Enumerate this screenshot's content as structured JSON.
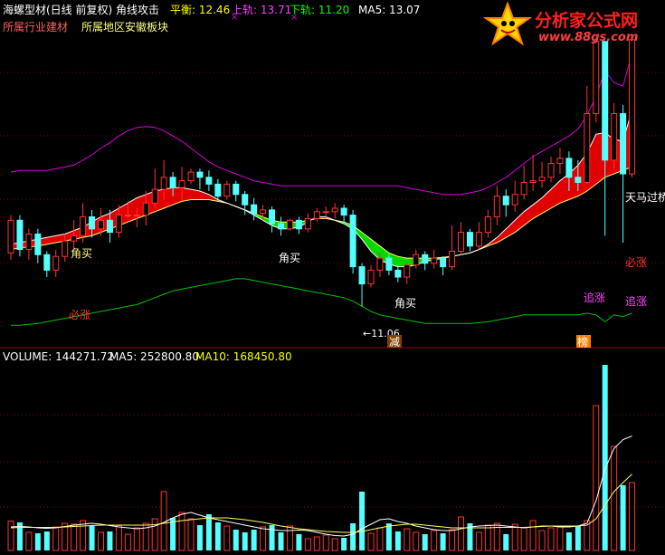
{
  "header": {
    "title": "海螺型材(日线 前复权) 角线攻击",
    "balance_label": "平衡: 12.46",
    "upper_label": "上轨: 13.71",
    "lower_label": "下轨: 11.20",
    "ma5_label": "MA5: 13.07",
    "industry": "所属行业建材",
    "region": "所属地区安徽板块"
  },
  "logo": {
    "name": "分析家公式网",
    "url": "www.88gs.com"
  },
  "volume_header": {
    "volume": "VOLUME: 144271.72",
    "ma5": "MA5: 252800.80",
    "ma10": "MA10: 168450.80"
  },
  "annotations": {
    "buy1": "角买",
    "buy2": "角买",
    "buy3": "角买",
    "bizhang1": "必涨",
    "bizhang2": "必涨",
    "zhuizhang1": "追涨",
    "zhuizhang2": "追涨",
    "low": "←11.06",
    "jian": "减",
    "bang": "榜",
    "tianma": "天马过桥"
  },
  "colors": {
    "up": "#ff3232",
    "down": "#54ffff",
    "upper_band": "#d400d4",
    "lower_band": "#00c000",
    "ma_white": "#ffffff",
    "ma_yellow": "#ffff60",
    "red_fill": "#e00000",
    "green_fill": "#00d800",
    "grid": "#800000",
    "balance": "#ffff00",
    "upper_text": "#ff40ff",
    "lower_text": "#00ff00",
    "industry": "#ff6060",
    "region": "#ffff80"
  },
  "chart_data": [
    {
      "type": "candlestick",
      "title": "海螺型材(日线 前复权) 角线攻击",
      "ylim": [
        10.6,
        14.2
      ],
      "candles": [
        [
          11.68,
          12.06,
          11.6,
          12.12
        ],
        [
          12.06,
          11.72,
          11.64,
          12.12
        ],
        [
          11.72,
          11.9,
          11.6,
          11.96
        ],
        [
          11.9,
          11.66,
          11.56,
          11.96
        ],
        [
          11.66,
          11.48,
          11.4,
          11.7
        ],
        [
          11.48,
          11.64,
          11.4,
          11.72
        ],
        [
          11.64,
          11.82,
          11.58,
          11.9
        ],
        [
          11.82,
          11.88,
          11.74,
          12.06
        ],
        [
          11.88,
          12.1,
          11.8,
          12.26
        ],
        [
          12.1,
          11.96,
          11.86,
          12.18
        ],
        [
          11.96,
          12.06,
          11.88,
          12.2
        ],
        [
          12.06,
          11.92,
          11.8,
          12.18
        ],
        [
          11.92,
          12.12,
          11.86,
          12.24
        ],
        [
          12.12,
          12.12,
          12.08,
          12.28
        ],
        [
          12.12,
          12.12,
          11.98,
          12.2
        ],
        [
          12.12,
          12.26,
          12.0,
          12.4
        ],
        [
          12.26,
          12.42,
          12.2,
          12.66
        ],
        [
          12.42,
          12.56,
          12.3,
          12.76
        ],
        [
          12.56,
          12.44,
          12.34,
          12.62
        ],
        [
          12.44,
          12.52,
          12.3,
          12.68
        ],
        [
          12.52,
          12.62,
          12.48,
          12.66
        ],
        [
          12.62,
          12.56,
          12.42,
          12.66
        ],
        [
          12.56,
          12.48,
          12.4,
          12.64
        ],
        [
          12.48,
          12.34,
          12.28,
          12.54
        ],
        [
          12.34,
          12.48,
          12.3,
          12.52
        ],
        [
          12.48,
          12.36,
          12.28,
          12.52
        ],
        [
          12.36,
          12.24,
          12.12,
          12.4
        ],
        [
          12.24,
          12.14,
          12.06,
          12.32
        ],
        [
          12.14,
          12.18,
          12.06,
          12.24
        ],
        [
          12.18,
          12.02,
          11.92,
          12.22
        ],
        [
          12.02,
          11.96,
          11.88,
          12.1
        ],
        [
          11.96,
          12.06,
          11.94,
          12.08
        ],
        [
          12.06,
          11.96,
          11.9,
          12.1
        ],
        [
          11.96,
          12.08,
          11.92,
          12.14
        ],
        [
          12.08,
          12.16,
          12.04,
          12.2
        ],
        [
          12.16,
          12.16,
          12.1,
          12.22
        ],
        [
          12.16,
          12.2,
          12.08,
          12.26
        ],
        [
          12.2,
          12.12,
          12.02,
          12.24
        ],
        [
          12.12,
          11.52,
          11.44,
          12.18
        ],
        [
          11.52,
          11.32,
          11.06,
          11.56
        ],
        [
          11.32,
          11.48,
          11.28,
          11.54
        ],
        [
          11.48,
          11.62,
          11.4,
          11.68
        ],
        [
          11.62,
          11.48,
          11.42,
          11.66
        ],
        [
          11.48,
          11.4,
          11.34,
          11.54
        ],
        [
          11.4,
          11.54,
          11.32,
          11.56
        ],
        [
          11.54,
          11.66,
          11.5,
          11.72
        ],
        [
          11.66,
          11.56,
          11.48,
          11.7
        ],
        [
          11.56,
          11.62,
          11.5,
          11.72
        ],
        [
          11.62,
          11.52,
          11.42,
          11.64
        ],
        [
          11.52,
          11.7,
          11.48,
          12.0
        ],
        [
          11.7,
          11.92,
          11.66,
          12.04
        ],
        [
          11.92,
          11.76,
          11.7,
          11.96
        ],
        [
          11.76,
          11.92,
          11.72,
          12.04
        ],
        [
          11.92,
          12.1,
          11.86,
          12.18
        ],
        [
          12.1,
          12.34,
          12.0,
          12.46
        ],
        [
          12.34,
          12.24,
          12.1,
          12.42
        ],
        [
          12.24,
          12.36,
          12.16,
          12.52
        ],
        [
          12.36,
          12.5,
          12.3,
          12.7
        ],
        [
          12.5,
          12.52,
          12.4,
          12.82
        ],
        [
          12.52,
          12.56,
          12.44,
          12.74
        ],
        [
          12.56,
          12.72,
          12.5,
          12.8
        ],
        [
          12.72,
          12.78,
          12.6,
          12.9
        ],
        [
          12.78,
          12.56,
          12.4,
          12.86
        ],
        [
          12.56,
          12.5,
          12.4,
          12.76
        ],
        [
          12.5,
          13.3,
          12.48,
          13.62
        ],
        [
          13.3,
          14.14,
          13.2,
          14.16
        ],
        [
          14.14,
          12.76,
          11.88,
          14.14
        ],
        [
          12.76,
          13.3,
          12.66,
          13.42
        ],
        [
          13.3,
          12.6,
          11.8,
          13.4
        ],
        [
          12.6,
          14.16,
          12.56,
          14.16
        ]
      ]
    },
    {
      "type": "line",
      "series": [
        {
          "name": "上轨",
          "color": "#d400d4",
          "values": [
            12.62,
            12.64,
            12.64,
            12.64,
            12.64,
            12.66,
            12.68,
            12.7,
            12.76,
            12.82,
            12.9,
            12.96,
            13.04,
            13.1,
            13.14,
            13.15,
            13.14,
            13.1,
            13.04,
            12.98,
            12.9,
            12.82,
            12.74,
            12.68,
            12.64,
            12.6,
            12.56,
            12.52,
            12.5,
            12.48,
            12.46,
            12.46,
            12.46,
            12.46,
            12.46,
            12.46,
            12.46,
            12.46,
            12.46,
            12.46,
            12.46,
            12.46,
            12.46,
            12.46,
            12.44,
            12.42,
            12.4,
            12.38,
            12.36,
            12.36,
            12.36,
            12.38,
            12.4,
            12.44,
            12.5,
            12.56,
            12.64,
            12.72,
            12.8,
            12.86,
            12.92,
            12.98,
            13.04,
            13.12,
            13.28,
            13.5,
            13.8,
            13.66,
            13.62,
            14.0
          ]
        },
        {
          "name": "平衡",
          "color": "#ffffff",
          "values": [
            11.78,
            11.8,
            11.82,
            11.84,
            11.86,
            11.88,
            11.9,
            11.94,
            11.98,
            12.04,
            12.1,
            12.14,
            12.2,
            12.26,
            12.32,
            12.36,
            12.4,
            12.42,
            12.44,
            12.44,
            12.42,
            12.4,
            12.36,
            12.3,
            12.26,
            12.22,
            12.18,
            12.12,
            12.06,
            12.0,
            11.96,
            11.96,
            11.98,
            12.04,
            12.1,
            12.1,
            12.06,
            12.02,
            11.96,
            11.84,
            11.7,
            11.6,
            11.55,
            11.52,
            11.52,
            11.54,
            11.58,
            11.6,
            11.62,
            11.64,
            11.66,
            11.68,
            11.72,
            11.78,
            11.86,
            11.96,
            12.06,
            12.16,
            12.24,
            12.32,
            12.42,
            12.52,
            12.6,
            12.7,
            12.84,
            13.06,
            13.08,
            13.0,
            12.98,
            13.34
          ]
        },
        {
          "name": "MA5",
          "color": "#ffff60",
          "values": [
            11.72,
            11.74,
            11.75,
            11.76,
            11.78,
            11.8,
            11.82,
            11.84,
            11.86,
            11.88,
            11.92,
            11.96,
            12.0,
            12.04,
            12.08,
            12.12,
            12.16,
            12.2,
            12.24,
            12.28,
            12.3,
            12.3,
            12.3,
            12.28,
            12.26,
            12.22,
            12.18,
            12.14,
            12.1,
            12.06,
            12.04,
            12.04,
            12.04,
            12.06,
            12.08,
            12.08,
            12.06,
            12.04,
            12.0,
            11.92,
            11.84,
            11.76,
            11.68,
            11.64,
            11.62,
            11.62,
            11.62,
            11.62,
            11.63,
            11.64,
            11.66,
            11.68,
            11.72,
            11.76,
            11.8,
            11.86,
            11.92,
            12.0,
            12.08,
            12.14,
            12.2,
            12.26,
            12.3,
            12.34,
            12.4,
            12.48,
            12.56,
            12.6,
            12.64,
            12.68
          ]
        },
        {
          "name": "下轨",
          "color": "#00c000",
          "values": [
            10.84,
            10.84,
            10.85,
            10.86,
            10.88,
            10.9,
            10.92,
            10.94,
            10.96,
            10.98,
            11.0,
            11.02,
            11.04,
            11.06,
            11.08,
            11.12,
            11.16,
            11.2,
            11.24,
            11.26,
            11.28,
            11.3,
            11.32,
            11.34,
            11.36,
            11.38,
            11.38,
            11.36,
            11.34,
            11.32,
            11.3,
            11.28,
            11.26,
            11.24,
            11.22,
            11.2,
            11.18,
            11.16,
            11.12,
            11.06,
            11.0,
            10.96,
            10.94,
            10.92,
            10.9,
            10.88,
            10.86,
            10.86,
            10.86,
            10.86,
            10.86,
            10.86,
            10.87,
            10.88,
            10.9,
            10.92,
            10.94,
            10.96,
            10.96,
            10.96,
            10.96,
            10.96,
            10.96,
            10.96,
            10.98,
            10.96,
            10.88,
            10.96,
            10.94,
            10.98
          ]
        }
      ]
    },
    {
      "type": "bar",
      "title": "VOLUME: 144271.72",
      "ylim": [
        0,
        420000
      ],
      "values": [
        65000,
        62000,
        40000,
        38000,
        42000,
        52000,
        60000,
        58000,
        66000,
        55000,
        40000,
        42000,
        55000,
        36000,
        50000,
        60000,
        70000,
        130000,
        72000,
        84000,
        70000,
        56000,
        80000,
        62000,
        54000,
        46000,
        40000,
        46000,
        52000,
        56000,
        40000,
        54000,
        36000,
        26000,
        30000,
        34000,
        26000,
        28000,
        60000,
        130000,
        38000,
        50000,
        60000,
        42000,
        48000,
        40000,
        36000,
        44000,
        38000,
        46000,
        74000,
        60000,
        40000,
        56000,
        60000,
        36000,
        58000,
        50000,
        66000,
        44000,
        50000,
        52000,
        40000,
        55000,
        66000,
        320000,
        410000,
        230000,
        144271.72,
        150000
      ],
      "ma5": [
        52000,
        53000,
        52000,
        50000,
        49000,
        50000,
        53000,
        56000,
        58000,
        60000,
        58000,
        55000,
        52000,
        50000,
        48000,
        50000,
        54000,
        62000,
        72000,
        80000,
        84000,
        78000,
        72000,
        68000,
        64000,
        60000,
        56000,
        52000,
        48000,
        46000,
        44000,
        44000,
        45000,
        44000,
        40000,
        36000,
        33000,
        32000,
        36000,
        48000,
        58000,
        68000,
        70000,
        64000,
        60000,
        54000,
        50000,
        46000,
        44000,
        44000,
        48000,
        52000,
        54000,
        55000,
        56000,
        54000,
        52000,
        50000,
        52000,
        54000,
        54000,
        52000,
        52000,
        54000,
        60000,
        110000,
        180000,
        225000,
        245000,
        252800.8
      ],
      "ma10": [
        50000,
        51000,
        51000,
        51000,
        51000,
        51000,
        52000,
        53000,
        54000,
        55000,
        56000,
        56000,
        56000,
        56000,
        56000,
        56000,
        57000,
        60000,
        63000,
        66000,
        68000,
        70000,
        72000,
        72000,
        72000,
        70000,
        68000,
        65000,
        62000,
        58000,
        54000,
        51000,
        48000,
        46000,
        44000,
        42000,
        41000,
        40000,
        40000,
        42000,
        46000,
        50000,
        54000,
        56000,
        58000,
        58000,
        56000,
        54000,
        52000,
        50000,
        50000,
        50000,
        50000,
        50000,
        51000,
        51000,
        51000,
        51000,
        52000,
        53000,
        54000,
        54000,
        54000,
        54000,
        56000,
        70000,
        100000,
        130000,
        150000,
        168450.8
      ]
    }
  ]
}
